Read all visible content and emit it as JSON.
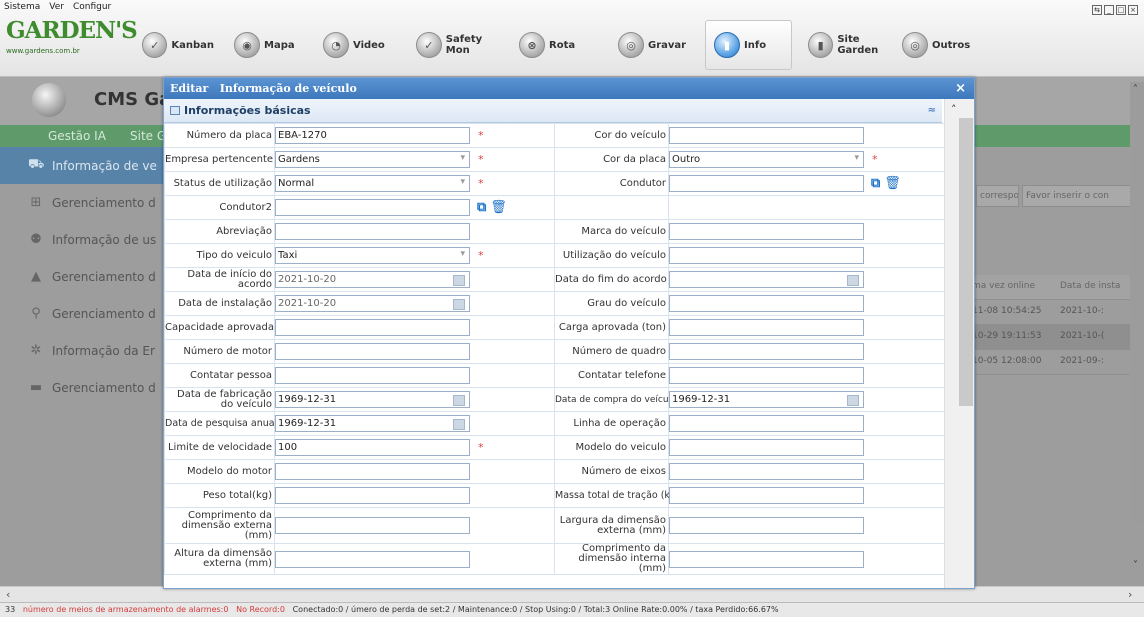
{
  "menubar": {
    "items": [
      "Sistema",
      "Ver",
      "Configur"
    ]
  },
  "logo": {
    "name": "GARDEN'S",
    "url": "www.gardens.com.br"
  },
  "nav": [
    {
      "label": "Kanban",
      "icon": "kanban-icon"
    },
    {
      "label": "Mapa",
      "icon": "map-icon"
    },
    {
      "label": "Video",
      "icon": "video-icon"
    },
    {
      "label": "Safety Mon",
      "icon": "safety-icon"
    },
    {
      "label": "Rota",
      "icon": "route-icon"
    },
    {
      "label": "Gravar",
      "icon": "record-icon"
    },
    {
      "label": "Info",
      "icon": "info-icon",
      "active": true
    },
    {
      "label": "Site Garden",
      "icon": "site-icon"
    },
    {
      "label": "Outros",
      "icon": "others-icon"
    }
  ],
  "app": {
    "title": "CMS Ga"
  },
  "greenbar": {
    "item1": "Gestão IA",
    "item2": "Site G"
  },
  "sidebar": {
    "items": [
      {
        "label": "Informação de ve",
        "icon": "bus-icon",
        "selected": true
      },
      {
        "label": "Gerenciamento d",
        "icon": "network-icon"
      },
      {
        "label": "Informação de us",
        "icon": "users-icon"
      },
      {
        "label": "Gerenciamento d",
        "icon": "driver-icon"
      },
      {
        "label": "Gerenciamento d",
        "icon": "location-pin-icon"
      },
      {
        "label": "Informação da Er",
        "icon": "company-icon"
      },
      {
        "label": "Gerenciamento d",
        "icon": "vehicle-icon"
      }
    ]
  },
  "rightpane": {
    "filter1": "correspo▾",
    "filter2": "Favor inserir o con",
    "headers": [
      "ma vez online",
      "Data de insta"
    ],
    "rows": [
      [
        "11-08 10:54:25",
        "2021-10-:"
      ],
      [
        "10-29 19:11:53",
        "2021-10-("
      ],
      [
        "10-05 12:08:00",
        "2021-09-:"
      ]
    ],
    "corner": "I:",
    "scroll_right": "›"
  },
  "modal": {
    "title": "Editar   Informação de veículo",
    "close": "×",
    "section": "Informações básicas",
    "collapse": "≈",
    "fields": {
      "placa_label": "Número da placa",
      "placa_value": "EBA-1270",
      "cor_veiculo_label": "Cor do veículo",
      "cor_veiculo_value": "",
      "empresa_label": "Empresa pertencente",
      "empresa_value": "Gardens",
      "cor_placa_label": "Cor da placa",
      "cor_placa_value": "Outro",
      "status_label": "Status de utilização",
      "status_value": "Normal",
      "condutor_label": "Condutor",
      "condutor_value": "",
      "condutor2_label": "Condutor2",
      "condutor2_value": "",
      "abreviacao_label": "Abreviação",
      "abreviacao_value": "",
      "marca_label": "Marca do veículo",
      "marca_value": "",
      "tipo_label": "Tipo do veiculo",
      "tipo_value": "Taxi",
      "utilizacao_label": "Utilização do veículo",
      "utilizacao_value": "",
      "inicio_label": "Data de início do acordo",
      "inicio_value": "2021-10-20",
      "fim_label": "Data do fim do acordo",
      "fim_value": "",
      "instalacao_label": "Data de instalação",
      "instalacao_value": "2021-10-20",
      "grau_label": "Grau do veículo",
      "grau_value": "",
      "capacidade_label": "Capacidade aprovada",
      "capacidade_value": "",
      "carga_label": "Carga aprovada (ton)",
      "carga_value": "",
      "motor_label": "Número de motor",
      "motor_value": "",
      "quadro_label": "Número de quadro",
      "quadro_value": "",
      "contato_label": "Contatar pessoa",
      "contato_value": "",
      "telefone_label": "Contatar telefone",
      "telefone_value": "",
      "fabricacao_label": "Data de fabricação do veículo",
      "fabricacao_value": "1969-12-31",
      "compra_label": "Data de compra do veículo",
      "compra_value": "1969-12-31",
      "pesquisa_label": "Data de pesquisa anual",
      "pesquisa_value": "1969-12-31",
      "linha_label": "Linha de operação",
      "linha_value": "",
      "velocidade_label": "Limite de velocidade",
      "velocidade_value": "100",
      "modelo_veiculo_label": "Modelo do veiculo",
      "modelo_veiculo_value": "",
      "modelo_motor_label": "Modelo do motor",
      "modelo_motor_value": "",
      "eixos_label": "Número de eixos",
      "eixos_value": "",
      "peso_label": "Peso total(kg)",
      "peso_value": "",
      "tracao_label": "Massa total de tração (kg)",
      "tracao_value": "",
      "comp_ext_label": "Comprimento da dimensão externa (mm)",
      "comp_ext_value": "",
      "larg_ext_label": "Largura da dimensão externa (mm)",
      "larg_ext_value": "",
      "alt_ext_label": "Altura da dimensão externa (mm)",
      "alt_ext_value": "",
      "comp_int_label": "Comprimento da dimensão interna (mm)",
      "comp_int_value": ""
    }
  },
  "statusbar": {
    "count": "33",
    "alarm": "número de meios de armazenamento de alarmes:0",
    "norecord": "No Record:0",
    "rest": "Conectado:0 / úmero de perda de set:2 / Maintenance:0 / Stop Using:0 / Total:3   Online Rate:0.00% / taxa Perdido:66.67%"
  },
  "bottomscroll": {
    "left": "‹",
    "right": "›"
  }
}
